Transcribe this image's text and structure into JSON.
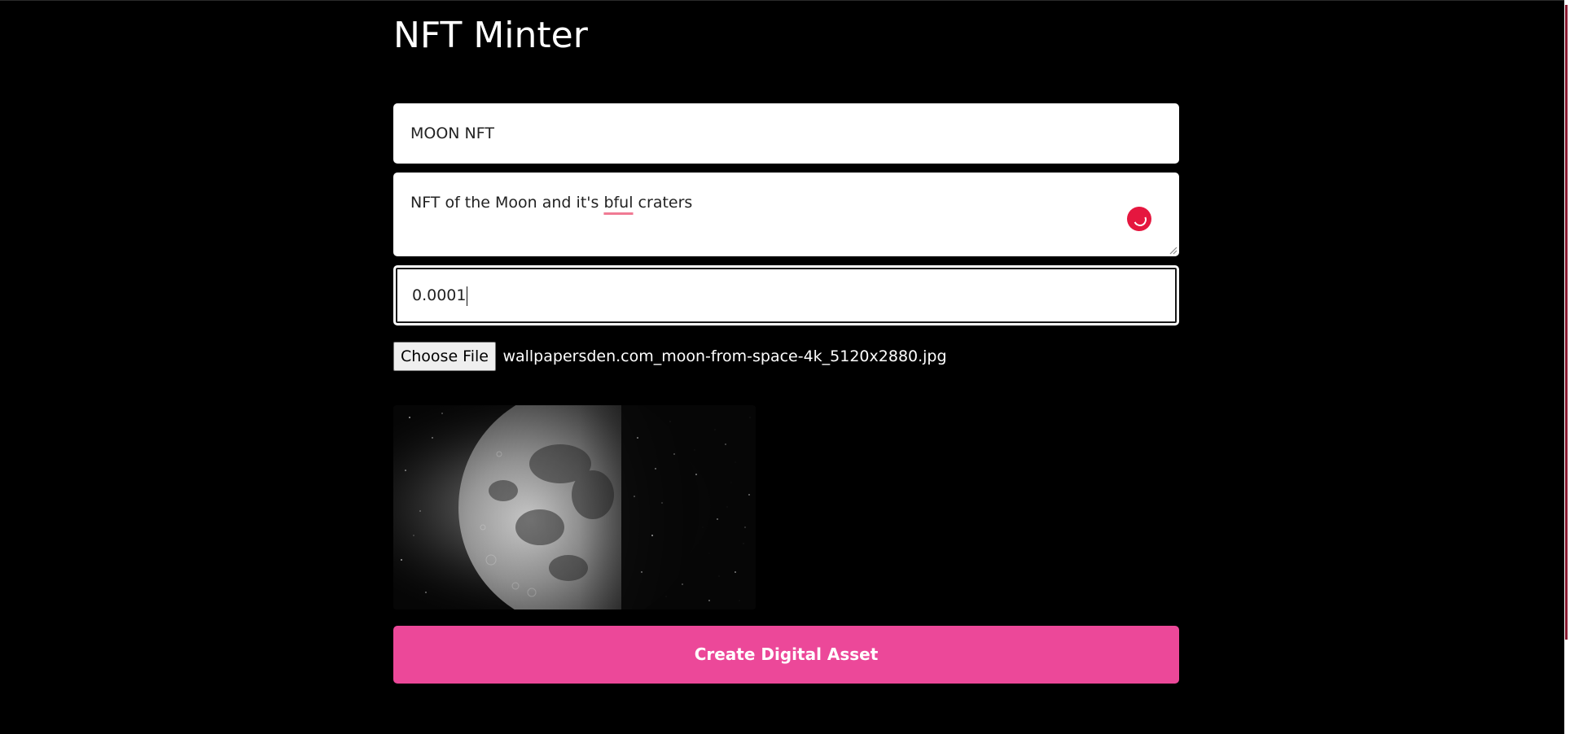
{
  "page": {
    "title": "NFT Minter"
  },
  "form": {
    "name_value": "MOON NFT",
    "description_before": "NFT of the Moon and it's ",
    "description_misspelled": "bful",
    "description_after": " craters",
    "price_value": "0.0001",
    "file_button_label": "Choose File",
    "file_name": "wallpapersden.com_moon-from-space-4k_5120x2880.jpg",
    "submit_label": "Create Digital Asset"
  },
  "preview": {
    "icon": "moon-image"
  },
  "colors": {
    "background": "#000000",
    "accent": "#ec4899",
    "field_background": "#ffffff",
    "spellcheck_underline": "#f07a94",
    "grammar_badge": "#e5173f"
  }
}
